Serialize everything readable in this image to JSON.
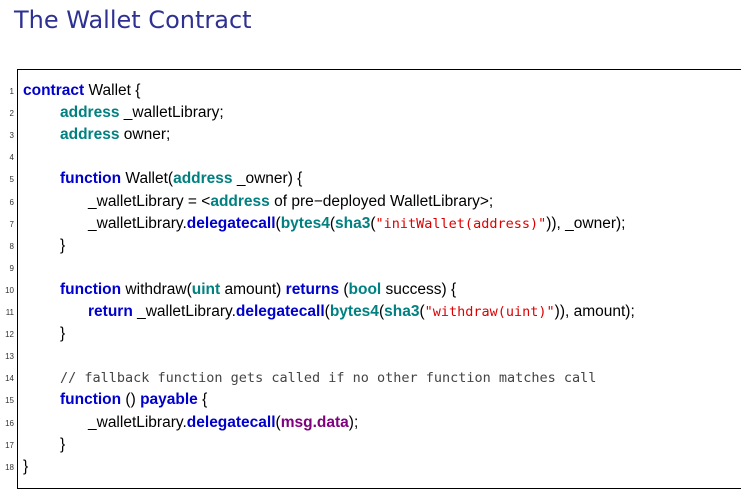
{
  "title": "The Wallet Contract",
  "code": {
    "lines": [
      {
        "n": "1",
        "indent": 0,
        "tokens": [
          {
            "t": "contract",
            "c": "kw"
          },
          {
            "t": " Wallet {",
            "c": ""
          }
        ]
      },
      {
        "n": "2",
        "indent": 1,
        "tokens": [
          {
            "t": "address",
            "c": "ty"
          },
          {
            "t": " _walletLibrary;",
            "c": ""
          }
        ]
      },
      {
        "n": "3",
        "indent": 1,
        "tokens": [
          {
            "t": "address",
            "c": "ty"
          },
          {
            "t": " owner;",
            "c": ""
          }
        ]
      },
      {
        "n": "4",
        "indent": 0,
        "tokens": []
      },
      {
        "n": "5",
        "indent": 1,
        "tokens": [
          {
            "t": "function",
            "c": "kw"
          },
          {
            "t": " Wallet(",
            "c": ""
          },
          {
            "t": "address",
            "c": "ty"
          },
          {
            "t": " _owner) {",
            "c": ""
          }
        ]
      },
      {
        "n": "6",
        "indent": 2,
        "tokens": [
          {
            "t": "_walletLibrary = <",
            "c": ""
          },
          {
            "t": "address",
            "c": "ty"
          },
          {
            "t": " of pre−deployed WalletLibrary>;",
            "c": ""
          }
        ]
      },
      {
        "n": "7",
        "indent": 2,
        "tokens": [
          {
            "t": "_walletLibrary.",
            "c": ""
          },
          {
            "t": "delegatecall",
            "c": "kw"
          },
          {
            "t": "(",
            "c": ""
          },
          {
            "t": "bytes4",
            "c": "ty"
          },
          {
            "t": "(",
            "c": ""
          },
          {
            "t": "sha3",
            "c": "ty"
          },
          {
            "t": "(",
            "c": ""
          },
          {
            "t": "\"initWallet(address)\"",
            "c": "str"
          },
          {
            "t": ")), _owner);",
            "c": ""
          }
        ]
      },
      {
        "n": "8",
        "indent": 1,
        "tokens": [
          {
            "t": "}",
            "c": ""
          }
        ]
      },
      {
        "n": "9",
        "indent": 0,
        "tokens": []
      },
      {
        "n": "10",
        "indent": 1,
        "tokens": [
          {
            "t": "function",
            "c": "kw"
          },
          {
            "t": " withdraw(",
            "c": ""
          },
          {
            "t": "uint",
            "c": "ty"
          },
          {
            "t": " amount) ",
            "c": ""
          },
          {
            "t": "returns",
            "c": "kw"
          },
          {
            "t": " (",
            "c": ""
          },
          {
            "t": "bool",
            "c": "ty"
          },
          {
            "t": " success) {",
            "c": ""
          }
        ]
      },
      {
        "n": "11",
        "indent": 2,
        "tokens": [
          {
            "t": "return",
            "c": "kw"
          },
          {
            "t": " _walletLibrary.",
            "c": ""
          },
          {
            "t": "delegatecall",
            "c": "kw"
          },
          {
            "t": "(",
            "c": ""
          },
          {
            "t": "bytes4",
            "c": "ty"
          },
          {
            "t": "(",
            "c": ""
          },
          {
            "t": "sha3",
            "c": "ty"
          },
          {
            "t": "(",
            "c": ""
          },
          {
            "t": "\"withdraw(uint)\"",
            "c": "str"
          },
          {
            "t": ")), amount);",
            "c": ""
          }
        ]
      },
      {
        "n": "12",
        "indent": 1,
        "tokens": [
          {
            "t": "}",
            "c": ""
          }
        ]
      },
      {
        "n": "13",
        "indent": 0,
        "tokens": []
      },
      {
        "n": "14",
        "indent": 1,
        "tokens": [
          {
            "t": "// fallback function gets called if no other function matches call",
            "c": "cmt"
          }
        ]
      },
      {
        "n": "15",
        "indent": 1,
        "tokens": [
          {
            "t": "function",
            "c": "kw"
          },
          {
            "t": " () ",
            "c": ""
          },
          {
            "t": "payable",
            "c": "kw"
          },
          {
            "t": " {",
            "c": ""
          }
        ]
      },
      {
        "n": "16",
        "indent": 2,
        "tokens": [
          {
            "t": "_walletLibrary.",
            "c": ""
          },
          {
            "t": "delegatecall",
            "c": "kw"
          },
          {
            "t": "(",
            "c": ""
          },
          {
            "t": "msg.data",
            "c": "msg"
          },
          {
            "t": ");",
            "c": ""
          }
        ]
      },
      {
        "n": "17",
        "indent": 1,
        "tokens": [
          {
            "t": "}",
            "c": ""
          }
        ]
      },
      {
        "n": "18",
        "indent": 0,
        "tokens": [
          {
            "t": "}",
            "c": ""
          }
        ]
      }
    ]
  }
}
